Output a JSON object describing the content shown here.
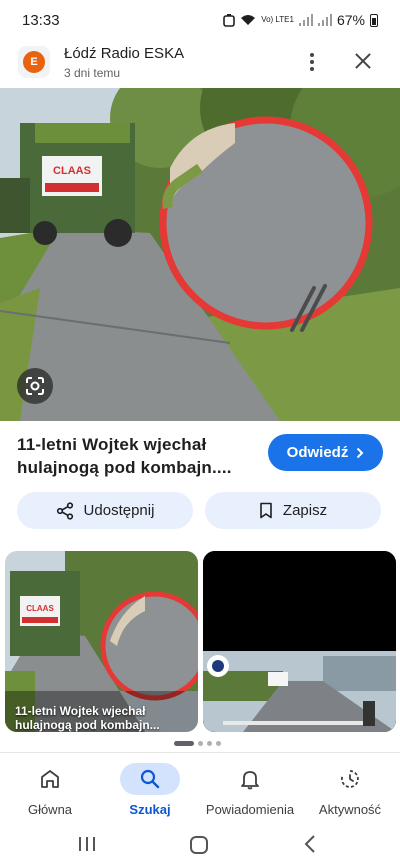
{
  "status_bar": {
    "time": "13:33",
    "network": "Vo) LTE1",
    "battery": "67%"
  },
  "source": {
    "logo_text": "E",
    "name": "Łódź Radio ESKA",
    "time": "3 dni temu"
  },
  "result": {
    "title": "11-letni Wojtek wjechał hulajnogą pod kombajn....",
    "visit_label": "Odwiedź"
  },
  "image_text": {
    "harvester_brand": "CLAAS"
  },
  "actions": {
    "share_label": "Udostępnij",
    "save_label": "Zapisz"
  },
  "related": [
    {
      "caption": "11-letni Wojtek wjechał hulajnogą pod kombajn..."
    },
    {
      "caption": ""
    }
  ],
  "carousel": {
    "pages": 4,
    "active": 0
  },
  "bottom_nav": [
    {
      "label": "Główna",
      "icon": "home-icon"
    },
    {
      "label": "Szukaj",
      "icon": "search-icon",
      "active": true
    },
    {
      "label": "Powiadomienia",
      "icon": "bell-icon"
    },
    {
      "label": "Aktywność",
      "icon": "activity-icon"
    }
  ],
  "colors": {
    "accent": "#1a73e8",
    "chip_bg": "#e8f0fe",
    "nav_active_bg": "#d3e3fd",
    "highlight_circle": "#e53935"
  }
}
